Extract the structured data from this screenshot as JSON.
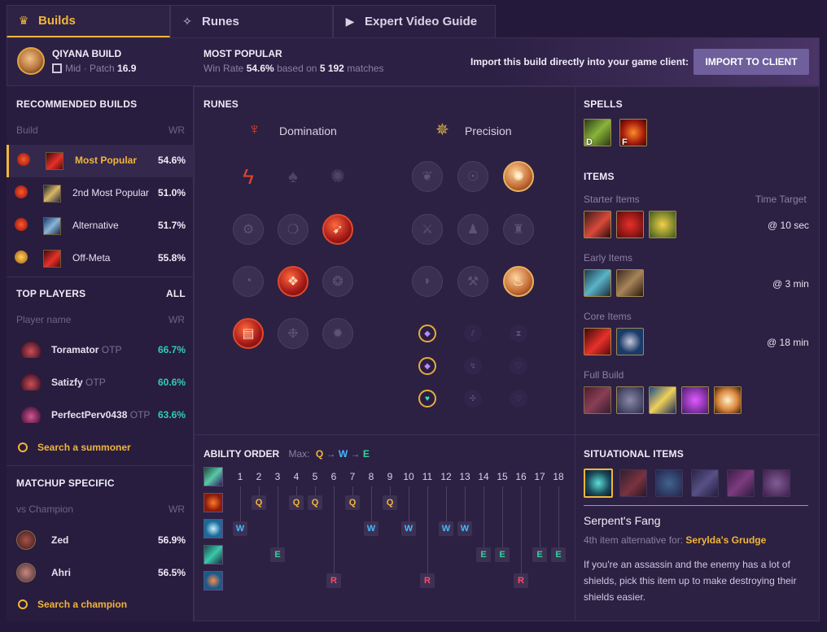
{
  "tabs": [
    {
      "label": "Builds",
      "icon": "crown-icon"
    },
    {
      "label": "Runes",
      "icon": "sparkle-icon"
    },
    {
      "label": "Expert Video Guide",
      "icon": "video-icon"
    }
  ],
  "header": {
    "champion_title": "QIYANA BUILD",
    "role": "Mid",
    "patch_label": "Patch",
    "patch": "16.9",
    "popular_title": "MOST POPULAR",
    "win_rate_label": "Win Rate",
    "win_rate": "54.6%",
    "based_on": "based on",
    "matches_count": "5 192",
    "matches_label": "matches",
    "import_text": "Import this build directly into your game client:",
    "import_button": "IMPORT TO CLIENT"
  },
  "recommended": {
    "title": "RECOMMENDED BUILDS",
    "col_build": "Build",
    "col_wr": "WR",
    "rows": [
      {
        "name": "Most Popular",
        "wr": "54.6%"
      },
      {
        "name": "2nd Most Popular",
        "wr": "51.0%"
      },
      {
        "name": "Alternative",
        "wr": "51.7%"
      },
      {
        "name": "Off-Meta",
        "wr": "55.8%"
      }
    ]
  },
  "top_players": {
    "title": "TOP PLAYERS",
    "all": "ALL",
    "col_name": "Player name",
    "col_wr": "WR",
    "rows": [
      {
        "name": "Toramator",
        "tag": "OTP",
        "wr": "66.7%"
      },
      {
        "name": "Satizfy",
        "tag": "OTP",
        "wr": "60.6%"
      },
      {
        "name": "PerfectPerv0438",
        "tag": "OTP",
        "wr": "63.6%"
      }
    ],
    "search": "Search a summoner"
  },
  "matchup": {
    "title": "MATCHUP SPECIFIC",
    "col_name": "vs Champion",
    "col_wr": "WR",
    "rows": [
      {
        "name": "Zed",
        "wr": "56.9%"
      },
      {
        "name": "Ahri",
        "wr": "56.5%"
      }
    ],
    "search": "Search a champion"
  },
  "runes": {
    "title": "RUNES",
    "primary": "Domination",
    "secondary": "Precision"
  },
  "spells": {
    "title": "SPELLS",
    "keys": [
      "D",
      "F"
    ]
  },
  "items": {
    "title": "ITEMS",
    "starter_label": "Starter Items",
    "time_target_label": "Time Target",
    "starter_time": "@ 10 sec",
    "early_label": "Early Items",
    "early_time": "@ 3 min",
    "core_label": "Core Items",
    "core_time": "@ 18 min",
    "full_label": "Full Build"
  },
  "ability": {
    "title": "ABILITY ORDER",
    "max_label": "Max:",
    "max_order": [
      "Q",
      "W",
      "E"
    ],
    "levels": [
      "1",
      "2",
      "3",
      "4",
      "5",
      "6",
      "7",
      "8",
      "9",
      "10",
      "11",
      "12",
      "13",
      "14",
      "15",
      "16",
      "17",
      "18"
    ],
    "q": "Q",
    "w": "W",
    "e": "E",
    "r": "R"
  },
  "situational": {
    "title": "SITUATIONAL ITEMS",
    "item_name": "Serpent's Fang",
    "alt_prefix": "4th item alternative for:",
    "alt_item": "Serylda's Grudge",
    "description": "If you're an assassin and the enemy has a lot of shields, pick this item up to make destroying their shields easier."
  },
  "colors": {
    "accent": "#f2b53b",
    "win_green": "#2ecfb1",
    "bg": "#24193a",
    "q": "#f2b53b",
    "w": "#47b7ff",
    "e": "#35d39a",
    "r": "#ff4a6a"
  }
}
